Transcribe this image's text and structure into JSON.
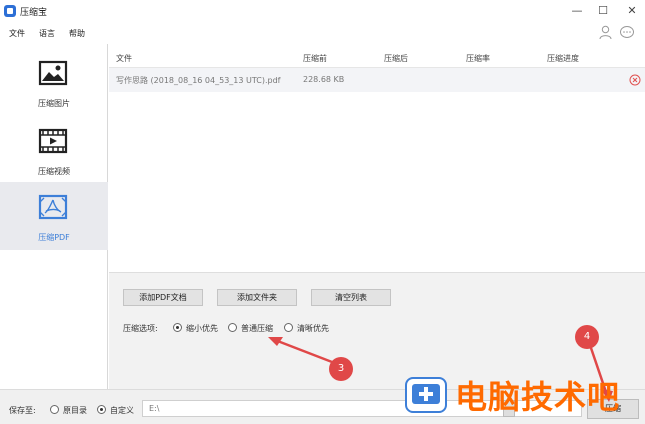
{
  "window": {
    "title": "压缩宝",
    "minimize_glyph": "—",
    "maximize_glyph": "☐",
    "close_glyph": "✕"
  },
  "menu": [
    "文件",
    "语言",
    "帮助"
  ],
  "header_icons": [
    "user-icon",
    "message-icon"
  ],
  "sidebar": {
    "items": [
      {
        "label": "压缩图片",
        "icon": "image-icon"
      },
      {
        "label": "压缩视频",
        "icon": "video-icon"
      },
      {
        "label": "压缩PDF",
        "icon": "pdf-icon",
        "active": true
      }
    ]
  },
  "table": {
    "columns": [
      "文件",
      "压缩前",
      "压缩后",
      "压缩率",
      "压缩进度"
    ],
    "rows": [
      {
        "file": "写作思路 (2018_08_16 04_53_13 UTC).pdf",
        "before": "228.68 KB",
        "after": "",
        "ratio": "",
        "progress": ""
      }
    ]
  },
  "actions": {
    "add_pdf": "添加PDF文档",
    "add_folder": "添加文件夹",
    "clear_list": "清空列表"
  },
  "options": {
    "label": "压缩选项:",
    "choices": [
      {
        "label": "缩小优先",
        "checked": true
      },
      {
        "label": "普通压缩",
        "checked": false
      },
      {
        "label": "清晰优先",
        "checked": false
      }
    ]
  },
  "footer": {
    "save_label": "保存至:",
    "choices": [
      {
        "label": "原目录",
        "checked": false
      },
      {
        "label": "自定义",
        "checked": true
      }
    ],
    "path_value": "E:\\",
    "compress_label": "压缩"
  },
  "annotations": [
    "3",
    "4"
  ],
  "watermark": {
    "text": "电脑技术吧"
  },
  "colors": {
    "accent": "#3d7fd8",
    "annotation": "#e04848",
    "watermark": "#ff6a00"
  }
}
